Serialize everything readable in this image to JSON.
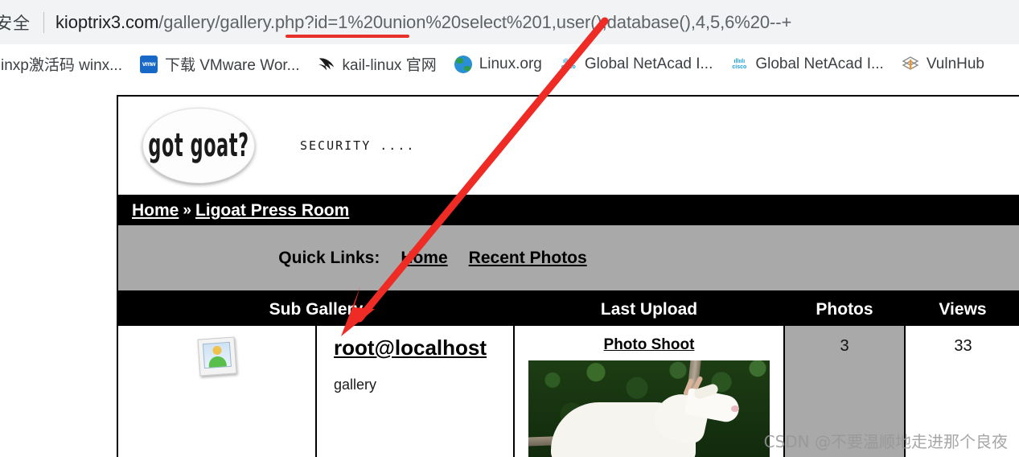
{
  "browser": {
    "security_label": "安全",
    "url_host": "kioptrix3.com",
    "url_path": "/gallery/gallery.php?id=1%20union%20select%201,user(),database(),4,5,6%20--+",
    "url_full": "kioptrix3.com/gallery/gallery.php?id=1%20union%20select%201,user(),database(),4,5,6%20--+",
    "bookmarks": [
      {
        "label": "inxp激活码 winx...",
        "icon": "none"
      },
      {
        "label": "下载 VMware Wor...",
        "icon": "vmware-icon"
      },
      {
        "label": "kail-linux 官网",
        "icon": "kali-dragon-icon"
      },
      {
        "label": "Linux.org",
        "icon": "globe-icon"
      },
      {
        "label": "Global NetAcad I...",
        "icon": "cisco-icon"
      },
      {
        "label": "Global NetAcad I...",
        "icon": "cisco-icon"
      },
      {
        "label": "VulnHub",
        "icon": "vulnhub-icon"
      }
    ]
  },
  "site": {
    "logo_text": "got goat?",
    "tagline": "SECURITY ....",
    "breadcrumb": {
      "home": "Home",
      "separator": "»",
      "current": "Ligoat Press Room"
    },
    "quick_links": {
      "label": "Quick Links:",
      "items": [
        "Home",
        "Recent Photos"
      ]
    },
    "table": {
      "headers": [
        "Sub Gallery",
        "Last Upload",
        "Photos",
        "Views"
      ],
      "rows": [
        {
          "icon": "photo-thumbnail-icon",
          "title": "root@localhost",
          "subtitle": "gallery",
          "last_upload_title": "Photo Shoot",
          "last_upload_image": "white-goat-photo",
          "photos": "3",
          "views": "33"
        }
      ]
    }
  },
  "annotations": {
    "arrow_color": "#ee2b24",
    "underline_color": "#e8312a",
    "arrow_from": "user() in URL",
    "arrow_to": "root@localhost cell"
  },
  "watermark": "CSDN @不要温顺地走进那个良夜"
}
